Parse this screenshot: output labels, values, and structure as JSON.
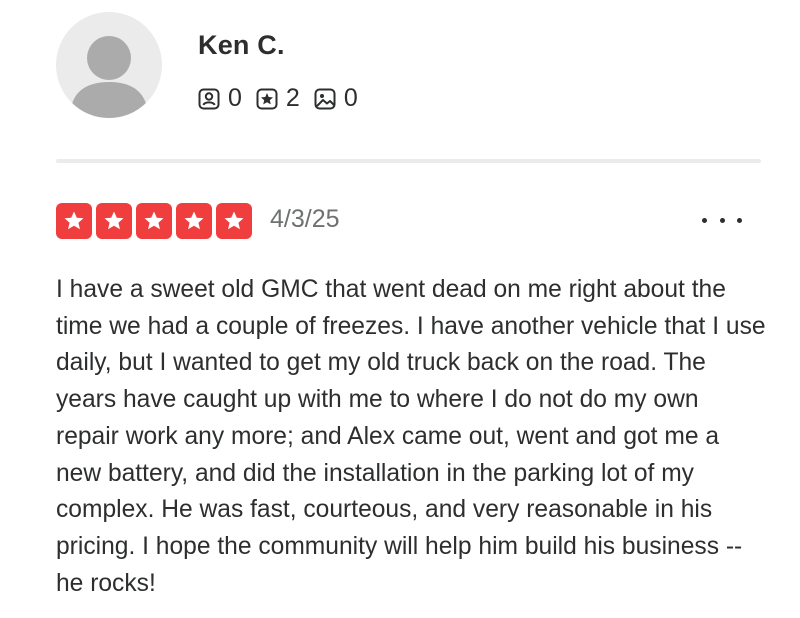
{
  "user": {
    "name": "Ken C.",
    "avatar_icon": "default-avatar-icon",
    "stats": {
      "friends": "0",
      "reviews": "2",
      "photos": "0"
    }
  },
  "review": {
    "rating": 5,
    "rating_max": 5,
    "date": "4/3/25",
    "more_icon": "more-options-icon",
    "text": "I have a sweet old GMC that went dead on me right about the time we had a couple of freezes. I have another vehicle that I use daily, but I wanted to get my old truck back on the road. The years have caught up with me to where I do not do my own repair work any more; and Alex came out, went and got me a new battery, and did the installation in the parking lot of my complex. He was fast, courteous, and very reasonable in his pricing. I hope the community will help him build his business -- he rocks!"
  },
  "colors": {
    "star_red": "#f03d3d",
    "text": "#2d2e2f",
    "muted": "#6e7072",
    "divider": "#ebebeb"
  }
}
